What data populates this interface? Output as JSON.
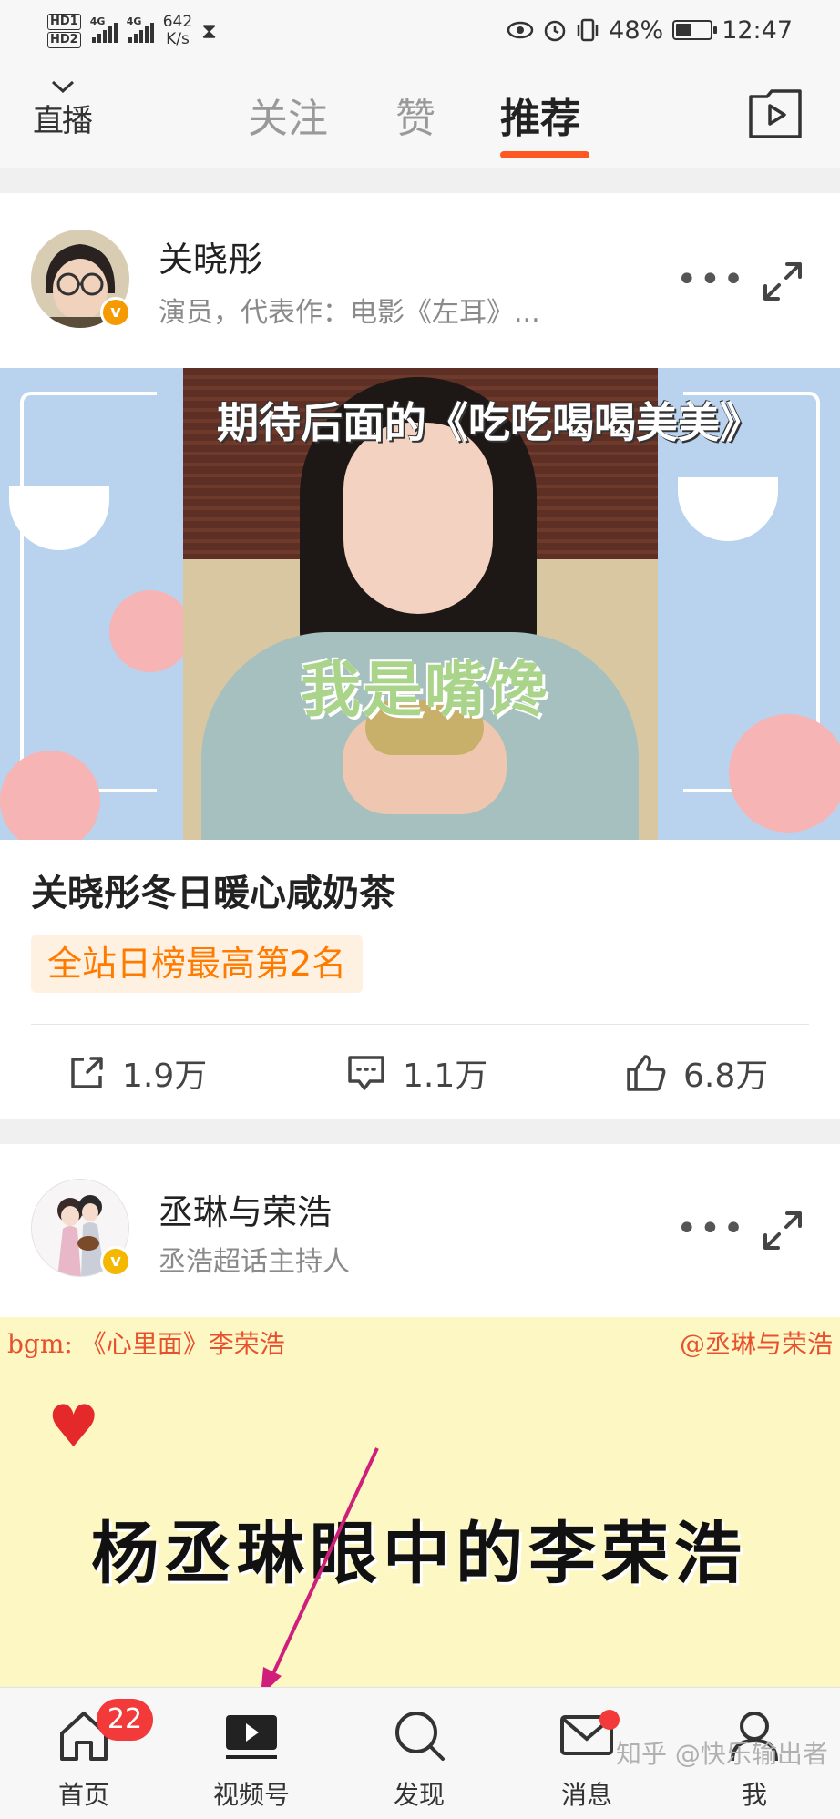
{
  "status_bar": {
    "hd1": "HD1",
    "hd2": "HD2",
    "network1": "4G",
    "network2": "4G",
    "speed_value": "642",
    "speed_unit": "K/s",
    "battery": "48%",
    "battery_level": 0.48,
    "time": "12:47"
  },
  "top_nav": {
    "live_label": "直播",
    "tabs": [
      {
        "label": "关注"
      },
      {
        "label": "赞"
      },
      {
        "label": "推荐"
      }
    ],
    "active_tab": "推荐"
  },
  "posts": [
    {
      "author": "关晓彤",
      "description": "演员，代表作：电影《左耳》...",
      "verified_color": "#f59a00",
      "video_caption_top": "期待后面的《吃吃喝喝美美》",
      "video_caption_mid": "我是嘴馋",
      "title": "关晓彤冬日暖心咸奶茶",
      "rank_badge": "全站日榜最高第2名",
      "stats": {
        "share": "1.9万",
        "comment": "1.1万",
        "like": "6.8万"
      }
    },
    {
      "author": "丞琳与荣浩",
      "description": "丞浩超话主持人",
      "verified_color": "#f5b800",
      "video_bgm": "bgm: 《心里面》李荣浩",
      "video_handle": "@丞琳与荣浩",
      "video_title": "杨丞琳眼中的李荣浩"
    }
  ],
  "bottom_nav": {
    "items": [
      {
        "label": "首页",
        "icon": "home-icon",
        "badge": "22"
      },
      {
        "label": "视频号",
        "icon": "video-play-icon"
      },
      {
        "label": "发现",
        "icon": "search-icon"
      },
      {
        "label": "消息",
        "icon": "mail-icon"
      },
      {
        "label": "我",
        "icon": "person-icon"
      }
    ]
  },
  "watermark": "知乎 @快乐输出者",
  "colors": {
    "accent": "#ff5722",
    "badge_red": "#f23a3a",
    "rank_text": "#ff7b00",
    "rank_bg": "#fff1e2"
  }
}
